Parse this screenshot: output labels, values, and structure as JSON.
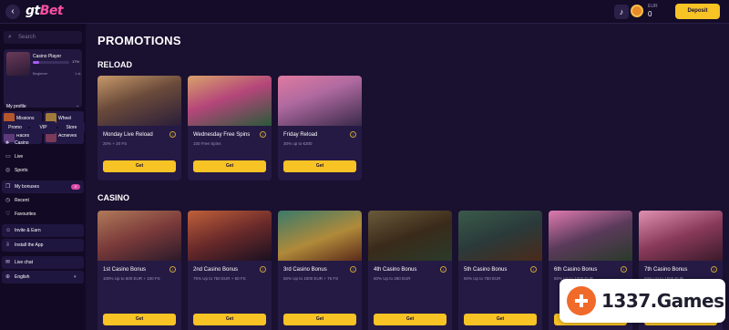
{
  "header": {
    "back_icon": "chevron-left-icon",
    "logo_left": "gt",
    "logo_right": "Bet",
    "bell_icon": "bell-icon",
    "balance_label": "EUR",
    "balance": "0",
    "deposit_label": "Deposit"
  },
  "sidebar": {
    "search_placeholder": "Search",
    "profile": {
      "name": "Casino Player",
      "level": "Beginner",
      "progress_percent": "17%",
      "progress": 0.17,
      "level_number": "1 st",
      "my_profile_label": "My profile"
    },
    "tiles": [
      {
        "label": "Missions",
        "color": "#b5562c"
      },
      {
        "label": "Wheel",
        "color": "#a07a3a"
      },
      {
        "label": "Races",
        "color": "#5c3a7a"
      },
      {
        "label": "Achieves",
        "color": "#7a3a58"
      }
    ],
    "tabs": [
      "Promo",
      "VIP",
      "Store"
    ],
    "nav": [
      {
        "label": "Casino",
        "icon": "cards-icon"
      },
      {
        "label": "Live",
        "icon": "live-icon"
      },
      {
        "label": "Sports",
        "icon": "ball-icon"
      },
      {
        "label": "My bonuses",
        "icon": "gift-icon",
        "badge": "0"
      },
      {
        "label": "Recent",
        "icon": "clock-icon"
      },
      {
        "label": "Favourites",
        "icon": "heart-icon"
      },
      {
        "label": "Invite & Earn",
        "icon": "invite-icon"
      },
      {
        "label": "Install the App",
        "icon": "download-icon"
      },
      {
        "label": "Live chat",
        "icon": "chat-icon"
      },
      {
        "label": "English",
        "icon": "globe-icon"
      }
    ]
  },
  "main": {
    "page_title": "PROMOTIONS",
    "reload_title": "RELOAD",
    "casino_title": "CASINO",
    "get_label": "Get",
    "reload_cards": [
      {
        "title": "Monday Live Reload",
        "desc": "20% + 20 FS",
        "art": "linear-gradient(160deg,#c79a6a 0%,#6a4a3a 45%,#2b1e3a 100%)"
      },
      {
        "title": "Wednesday Free Spins",
        "desc": "100 Free Spins",
        "art": "linear-gradient(160deg,#d8a26a 0%,#b5467a 45%,#2a5a3a 100%)"
      },
      {
        "title": "Friday Reload",
        "desc": "30% up to €200",
        "art": "linear-gradient(160deg,#e07aa0 0%,#b06aa0 40%,#3a2a4a 100%)"
      }
    ],
    "casino_cards": [
      {
        "title": "1st Casino Bonus",
        "desc": "100% Up to 500 EUR + 100 FS",
        "art": "linear-gradient(160deg,#b07a5a 0%,#7a3a3a 50%,#2a1a2a 100%)"
      },
      {
        "title": "2nd Casino Bonus",
        "desc": "75% Up to 750 EUR + 50 FS",
        "art": "linear-gradient(160deg,#c0603a 0%,#6a2a2a 50%,#1a1020 100%)"
      },
      {
        "title": "3rd Casino Bonus",
        "desc": "50% Up to 1000 EUR + 75 FS",
        "art": "linear-gradient(160deg,#3a7a6a 0%,#b08a3a 55%,#5a2a1a 100%)"
      },
      {
        "title": "4th Casino Bonus",
        "desc": "50% Up to 250 EUR",
        "art": "linear-gradient(160deg,#6a5a3a 0%,#3a2a1a 50%,#2a3a2a 100%)"
      },
      {
        "title": "5th Casino Bonus",
        "desc": "50% Up to 750 EUR",
        "art": "linear-gradient(160deg,#3a5a4a 0%,#2a3a3a 50%,#4a2a1a 100%)"
      },
      {
        "title": "6th Casino Bonus",
        "desc": "50% Up to 1000 EUR",
        "art": "linear-gradient(160deg,#e07ab0 0%,#5a3a5a 50%,#2a3a2a 100%)"
      },
      {
        "title": "7th Casino Bonus",
        "desc": "50% Up to 1500 EUR",
        "art": "linear-gradient(160deg,#e090b0 0%,#8a3a5a 50%,#3a1a2a 100%)"
      }
    ]
  },
  "watermark": {
    "text": "1337.Games"
  },
  "colors": {
    "accent": "#f7c325",
    "background": "#1a1030",
    "card": "#251a44"
  }
}
